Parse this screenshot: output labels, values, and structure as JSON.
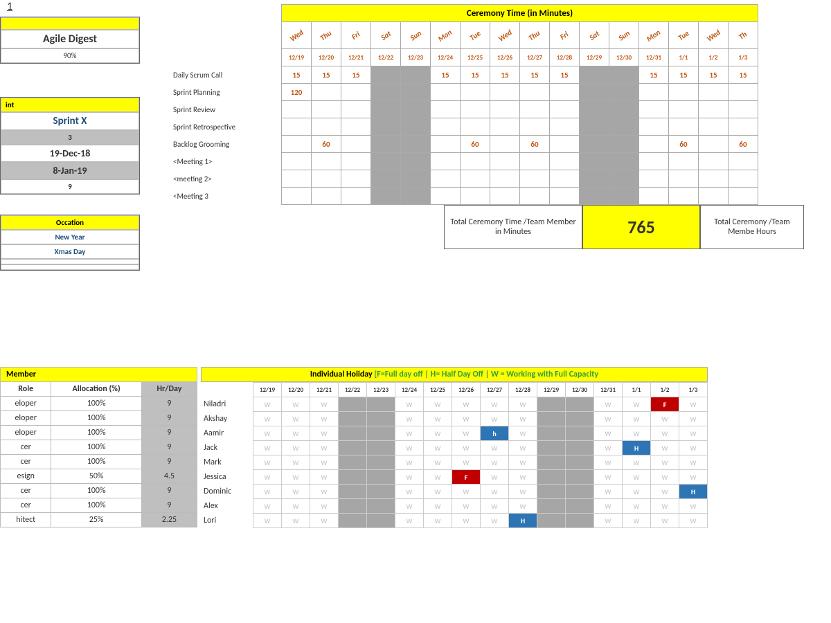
{
  "org": {
    "name": "Agile Digest",
    "capacity": "90%"
  },
  "sprint": {
    "header": "int",
    "name": "Sprint X",
    "weeks": "3",
    "start": "19-Dec-18",
    "end": "8-Jan-19",
    "workdays": "9"
  },
  "occasion": {
    "header": "Occation",
    "items": [
      "New Year",
      "Xmas Day",
      "",
      ""
    ]
  },
  "ceremony": {
    "title": "Ceremony Time (in Minutes)",
    "days": [
      "Wed",
      "Thu",
      "Fri",
      "Sat",
      "Sun",
      "Mon",
      "Tue",
      "Wed",
      "Thu",
      "Fri",
      "Sat",
      "Sun",
      "Mon",
      "Tue",
      "Wed",
      "Th"
    ],
    "dates": [
      "12/19",
      "12/20",
      "12/21",
      "12/22",
      "12/23",
      "12/24",
      "12/25",
      "12/26",
      "12/27",
      "12/28",
      "12/29",
      "12/30",
      "12/31",
      "1/1",
      "1/2",
      "1/3"
    ],
    "weekend_idx": [
      3,
      4,
      10,
      11
    ],
    "rows": [
      {
        "label": "Daily Scrum Call",
        "v": [
          "15",
          "15",
          "15",
          "",
          "",
          "15",
          "15",
          "15",
          "15",
          "15",
          "",
          "",
          "15",
          "15",
          "15",
          "15"
        ]
      },
      {
        "label": "Sprint Planning",
        "v": [
          "120",
          "",
          "",
          "",
          "",
          "",
          "",
          "",
          "",
          "",
          "",
          "",
          "",
          "",
          "",
          ""
        ]
      },
      {
        "label": "Sprint Review",
        "v": [
          "",
          "",
          "",
          "",
          "",
          "",
          "",
          "",
          "",
          "",
          "",
          "",
          "",
          "",
          "",
          ""
        ]
      },
      {
        "label": "Sprint Retrospective",
        "v": [
          "",
          "",
          "",
          "",
          "",
          "",
          "",
          "",
          "",
          "",
          "",
          "",
          "",
          "",
          "",
          ""
        ]
      },
      {
        "label": "Backlog Grooming",
        "v": [
          "",
          "60",
          "",
          "",
          "",
          "",
          "60",
          "",
          "60",
          "",
          "",
          "",
          "",
          "60",
          "",
          "60"
        ]
      },
      {
        "label": "<Meeting 1>",
        "v": [
          "",
          "",
          "",
          "",
          "",
          "",
          "",
          "",
          "",
          "",
          "",
          "",
          "",
          "",
          "",
          ""
        ]
      },
      {
        "label": "<meeting 2>",
        "v": [
          "",
          "",
          "",
          "",
          "",
          "",
          "",
          "",
          "",
          "",
          "",
          "",
          "",
          "",
          "",
          ""
        ]
      },
      {
        "label": "<Meeting 3",
        "v": [
          "",
          "",
          "",
          "",
          "",
          "",
          "",
          "",
          "",
          "",
          "",
          "",
          "",
          "",
          "",
          ""
        ]
      }
    ],
    "total_label_min": "Total Ceremony Time /Team Member in Minutes",
    "total_min": "765",
    "total_label_hr": "Total Ceremony /Team Membe Hours"
  },
  "members": {
    "header": "Member",
    "cols": [
      "Role",
      "Allocation (%)",
      "Hr/Day"
    ],
    "rows": [
      {
        "role": "eloper",
        "alloc": "100%",
        "hr": "9"
      },
      {
        "role": "eloper",
        "alloc": "100%",
        "hr": "9"
      },
      {
        "role": "eloper",
        "alloc": "100%",
        "hr": "9"
      },
      {
        "role": "cer",
        "alloc": "100%",
        "hr": "9"
      },
      {
        "role": "cer",
        "alloc": "100%",
        "hr": "9"
      },
      {
        "role": "esign",
        "alloc": "50%",
        "hr": "4.5"
      },
      {
        "role": "cer",
        "alloc": "100%",
        "hr": "9"
      },
      {
        "role": "cer",
        "alloc": "100%",
        "hr": "9"
      },
      {
        "role": "hitect",
        "alloc": "25%",
        "hr": "2.25"
      }
    ]
  },
  "holiday": {
    "title": "Individual Holiday",
    "legend": "[F=Full day off | H= Half Day Off | W = Working with Full Capacity",
    "dates": [
      "12/19",
      "12/20",
      "12/21",
      "12/22",
      "12/23",
      "12/24",
      "12/25",
      "12/26",
      "12/27",
      "12/28",
      "12/29",
      "12/30",
      "12/31",
      "1/1",
      "1/2",
      "1/3"
    ],
    "weekend_idx": [
      3,
      4,
      10,
      11
    ],
    "rows": [
      {
        "name": "Niladri",
        "v": [
          "W",
          "W",
          "W",
          "",
          "",
          "W",
          "W",
          "W",
          "W",
          "W",
          "",
          "",
          "W",
          "W",
          "F",
          "W"
        ]
      },
      {
        "name": "Akshay",
        "v": [
          "W",
          "W",
          "W",
          "",
          "",
          "W",
          "W",
          "W",
          "W",
          "W",
          "",
          "",
          "W",
          "W",
          "W",
          "W"
        ]
      },
      {
        "name": "Aamir",
        "v": [
          "W",
          "W",
          "W",
          "",
          "",
          "W",
          "W",
          "W",
          "h",
          "W",
          "",
          "",
          "W",
          "W",
          "W",
          "W"
        ]
      },
      {
        "name": "Jack",
        "v": [
          "W",
          "W",
          "W",
          "",
          "",
          "W",
          "W",
          "W",
          "W",
          "W",
          "",
          "",
          "W",
          "H",
          "W",
          "W"
        ]
      },
      {
        "name": "Mark",
        "v": [
          "W",
          "W",
          "W",
          "",
          "",
          "W",
          "W",
          "W",
          "W",
          "W",
          "",
          "",
          "W",
          "W",
          "W",
          "W"
        ]
      },
      {
        "name": "Jessica",
        "v": [
          "W",
          "W",
          "W",
          "",
          "",
          "W",
          "W",
          "F",
          "W",
          "W",
          "",
          "",
          "W",
          "W",
          "W",
          "W"
        ]
      },
      {
        "name": "Dominic",
        "v": [
          "W",
          "W",
          "W",
          "",
          "",
          "W",
          "W",
          "W",
          "W",
          "W",
          "",
          "",
          "W",
          "W",
          "W",
          "H"
        ]
      },
      {
        "name": "Alex",
        "v": [
          "W",
          "W",
          "W",
          "",
          "",
          "W",
          "W",
          "W",
          "W",
          "W",
          "",
          "",
          "W",
          "W",
          "W",
          "W"
        ]
      },
      {
        "name": "Lori",
        "v": [
          "W",
          "W",
          "W",
          "",
          "",
          "W",
          "W",
          "W",
          "W",
          "H",
          "",
          "",
          "W",
          "W",
          "W",
          "W"
        ]
      }
    ]
  }
}
